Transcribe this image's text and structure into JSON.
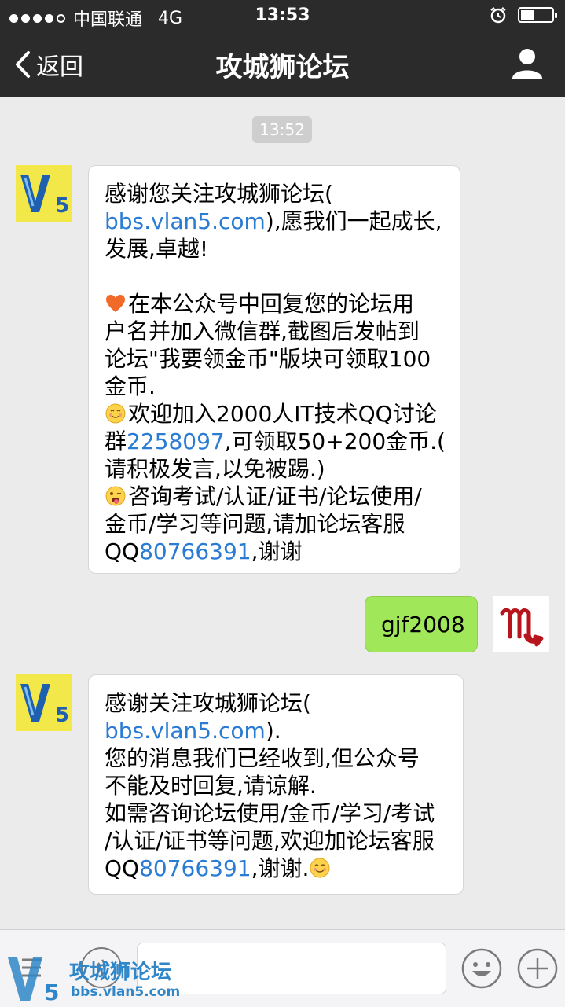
{
  "status_bar": {
    "carrier": "中国联通",
    "network": "4G",
    "time": "13:53",
    "alarm_icon": "alarm-icon",
    "battery_icon": "battery-icon"
  },
  "nav": {
    "back_label": "返回",
    "title": "攻城狮论坛",
    "profile_icon": "person-icon"
  },
  "chat": {
    "timestamp": "13:52",
    "messages": [
      {
        "sender": "official-account",
        "avatar": "V5",
        "lines": [
          [
            "感谢您关注攻城狮论坛("
          ],
          [
            "bbs.vlan5.com",
            "),愿我们一起成长,"
          ],
          [
            "发展,卓越!"
          ],
          [
            "在本公众号中回复您的论坛用"
          ],
          [
            "户名并加入微信群,截图后发帖到"
          ],
          [
            "论坛\"我要领金币\"版块可领取100"
          ],
          [
            "金币."
          ],
          [
            "欢迎加入2000人IT技术QQ讨论"
          ],
          [
            "群",
            "2258097",
            ",可领取50+200金币.("
          ],
          [
            "请积极发言,以免被踢.)"
          ],
          [
            "咨询考试/认证/证书/论坛使用/"
          ],
          [
            "金币/学习等问题,请加论坛客服"
          ],
          [
            "QQ",
            "80766391",
            ",谢谢"
          ]
        ]
      },
      {
        "sender": "me",
        "avatar": "M",
        "text": "gjf2008"
      },
      {
        "sender": "official-account",
        "avatar": "V5",
        "lines": [
          [
            "感谢关注攻城狮论坛("
          ],
          [
            "bbs.vlan5.com",
            ")."
          ],
          [
            "您的消息我们已经收到,但公众号"
          ],
          [
            "不能及时回复,请谅解."
          ],
          [
            "如需咨询论坛使用/金币/学习/考试"
          ],
          [
            "/认证/证书等问题,欢迎加论坛客服"
          ],
          [
            "QQ",
            "80766391",
            ",谢谢."
          ]
        ]
      }
    ]
  },
  "watermark": {
    "title": "攻城狮论坛",
    "url": "bbs.vlan5.com"
  },
  "colors": {
    "nav_bg": "#2b2b2b",
    "chat_bg": "#ebebeb",
    "sent_bubble": "#a0e75a",
    "link": "#2a7bd4"
  }
}
